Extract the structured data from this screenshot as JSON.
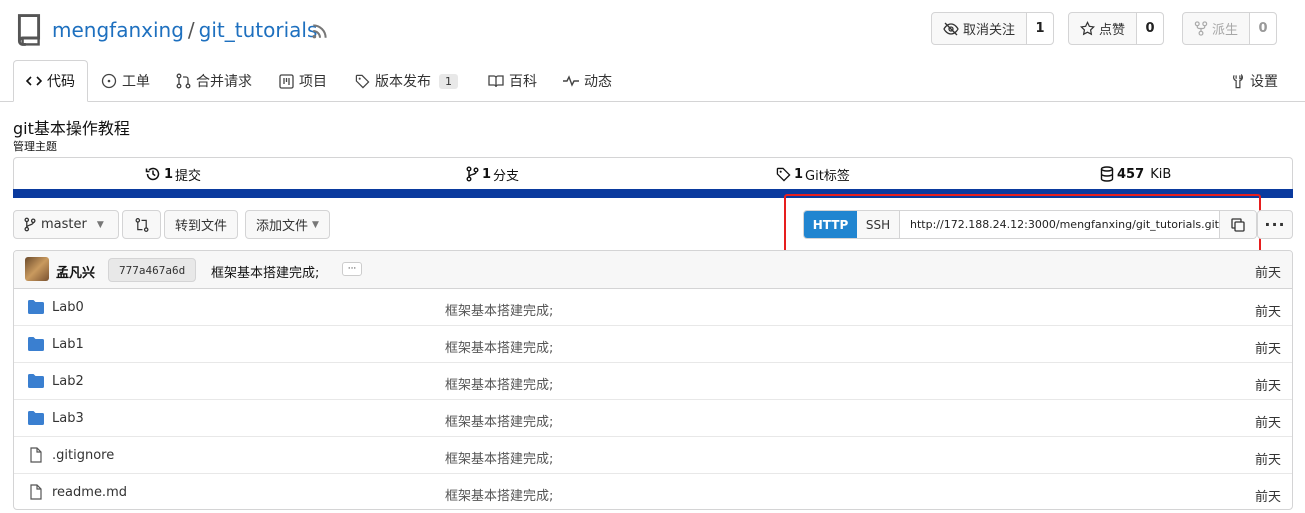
{
  "repo": {
    "owner": "mengfanxing",
    "separator": "/",
    "name": "git_tutorials"
  },
  "header_buttons": {
    "unwatch": {
      "label": "取消关注",
      "count": "1"
    },
    "star": {
      "label": "点赞",
      "count": "0"
    },
    "fork": {
      "label": "派生",
      "count": "0"
    }
  },
  "tabs": {
    "code": "代码",
    "issues": "工单",
    "pulls": "合并请求",
    "projects": "项目",
    "releases": "版本发布",
    "releases_count": "1",
    "wiki": "百科",
    "activity": "动态",
    "settings": "设置"
  },
  "description": "git基本操作教程",
  "topics_label": "管理主题",
  "stats": {
    "commits_num": "1",
    "commits_label": "提交",
    "branches_num": "1",
    "branches_label": "分支",
    "tags_num": "1",
    "tags_label": "Git标签",
    "size_num": "457",
    "size_unit": "KiB"
  },
  "toolbar": {
    "branch": "master",
    "go_to_file": "转到文件",
    "add_file": "添加文件",
    "more": "···"
  },
  "clone": {
    "http": "HTTP",
    "ssh": "SSH",
    "url": "http://172.188.24.12:3000/mengfanxing/git_tutorials.git"
  },
  "latest_commit": {
    "author": "孟凡兴",
    "sha": "777a467a6d",
    "message": "框架基本搭建完成;",
    "ellipsis": "···",
    "time": "前天"
  },
  "files": [
    {
      "type": "folder",
      "name": "Lab0",
      "message": "框架基本搭建完成;",
      "time": "前天"
    },
    {
      "type": "folder",
      "name": "Lab1",
      "message": "框架基本搭建完成;",
      "time": "前天"
    },
    {
      "type": "folder",
      "name": "Lab2",
      "message": "框架基本搭建完成;",
      "time": "前天"
    },
    {
      "type": "folder",
      "name": "Lab3",
      "message": "框架基本搭建完成;",
      "time": "前天"
    },
    {
      "type": "file",
      "name": ".gitignore",
      "message": "框架基本搭建完成;",
      "time": "前天"
    },
    {
      "type": "file",
      "name": "readme.md",
      "message": "框架基本搭建完成;",
      "time": "前天"
    }
  ],
  "colors": {
    "link": "#1e70bf",
    "primary": "#2185d0",
    "language_bar": "#0a3a9e",
    "folder": "#3a7fd0",
    "highlight": "#e61e1e"
  }
}
